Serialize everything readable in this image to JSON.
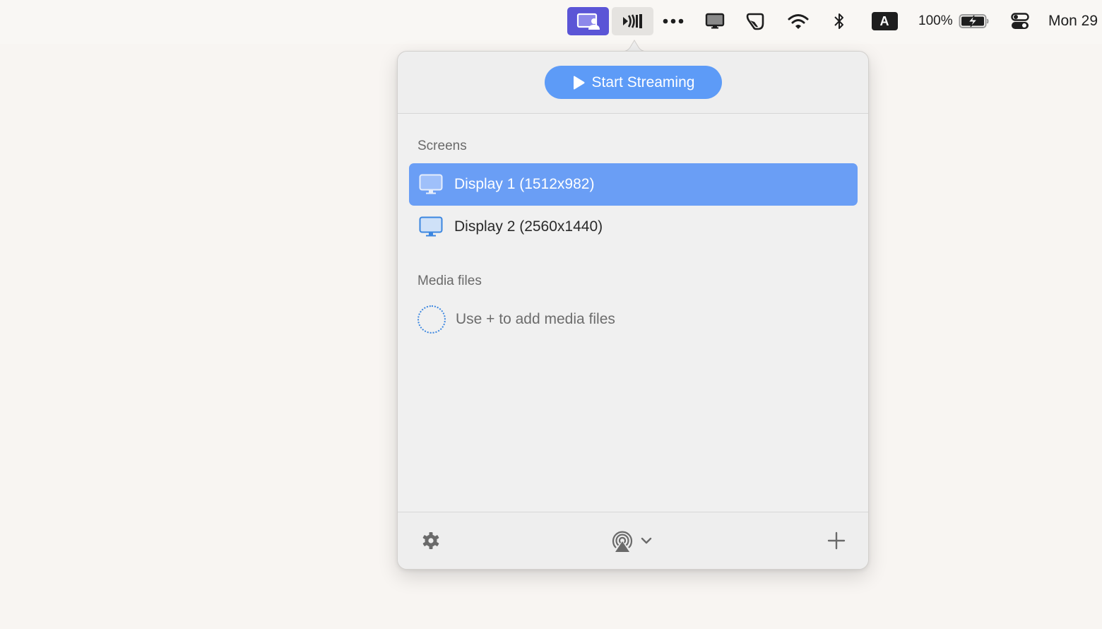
{
  "menubar": {
    "items": [
      {
        "name": "screen-share-app",
        "icon": "screen-person-icon",
        "active": true,
        "accent": "#5b55d6"
      },
      {
        "name": "streaming-app",
        "icon": "cast-waves-icon",
        "highlighted": true
      },
      {
        "name": "more",
        "icon": "ellipsis-icon"
      },
      {
        "name": "display",
        "icon": "monitor-icon"
      },
      {
        "name": "hook",
        "icon": "hook-icon"
      },
      {
        "name": "wifi",
        "icon": "wifi-icon"
      },
      {
        "name": "bluetooth",
        "icon": "bluetooth-icon"
      },
      {
        "name": "input-source",
        "icon": "input-source-icon",
        "label": "A"
      },
      {
        "name": "battery",
        "icon": "battery-charging-icon",
        "percent_label": "100%",
        "level": 1.0
      },
      {
        "name": "control-center",
        "icon": "toggle-switches-icon"
      }
    ],
    "clock": "Mon 29"
  },
  "popover": {
    "start_button": {
      "label": "Start Streaming",
      "icon": "play-icon",
      "color": "#5d9bf7"
    },
    "screens": {
      "label": "Screens",
      "items": [
        {
          "label": "Display 1 (1512x982)",
          "icon": "monitor-icon",
          "selected": true
        },
        {
          "label": "Display 2 (2560x1440)",
          "icon": "monitor-icon",
          "selected": false
        }
      ],
      "selected_color": "#6a9ef5"
    },
    "media": {
      "label": "Media files",
      "empty_hint": "Use + to add media files",
      "empty_icon": "dashed-circle-icon"
    },
    "footer": {
      "settings_icon": "gear-icon",
      "airplay_icon": "airplay-icon",
      "dropdown_icon": "chevron-down-icon",
      "add_icon": "plus-icon"
    }
  }
}
